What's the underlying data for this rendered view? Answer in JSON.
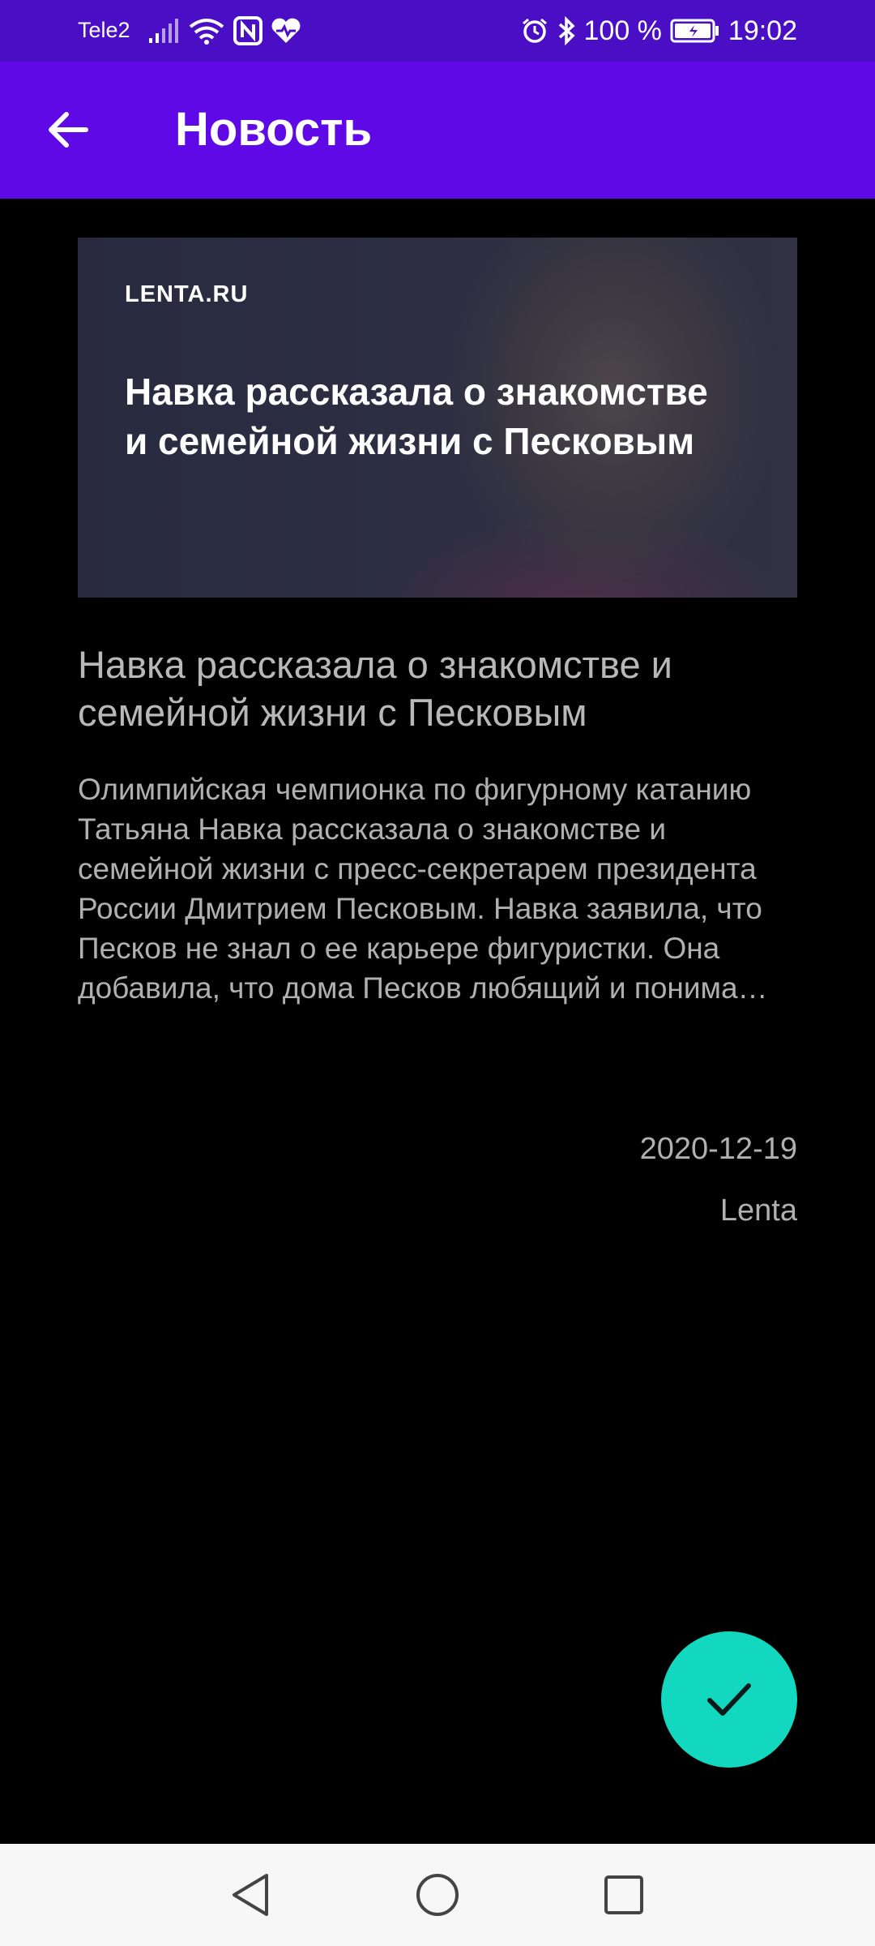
{
  "status_bar": {
    "carrier": "Tele2",
    "battery": "100 %",
    "time": "19:02",
    "icons": [
      "signal-icon",
      "wifi-icon",
      "nfc-icon",
      "health-icon",
      "alarm-icon",
      "bluetooth-icon",
      "battery-icon"
    ]
  },
  "app_bar": {
    "title": "Новость",
    "back_icon": "arrow-back-icon"
  },
  "hero": {
    "logo": "LENTA.RU",
    "headline": "Навка рассказала о знакомстве и семейной жизни с Песковым"
  },
  "article": {
    "title": "Навка рассказала о знакомстве и семейной жизни с Песковым",
    "body": "Олимпийская чемпионка по фигурному катанию Татьяна Навка рассказала о знакомстве и семейной жизни с пресс-секретарем президента России Дмитрием Песковым. Навка заявила, что Песков не знал о ее карьере фигуристки. Она добавила, что дома Песков любящий и понима…",
    "date": "2020-12-19",
    "source": "Lenta"
  },
  "fab": {
    "icon": "check-icon",
    "color": "#12d8c0"
  },
  "colors": {
    "app_bar": "#5f0ae6",
    "status_bar": "#4a0fc4",
    "background": "#000000"
  },
  "nav_bar": {
    "icons": [
      "nav-back-icon",
      "nav-home-icon",
      "nav-recents-icon"
    ]
  }
}
